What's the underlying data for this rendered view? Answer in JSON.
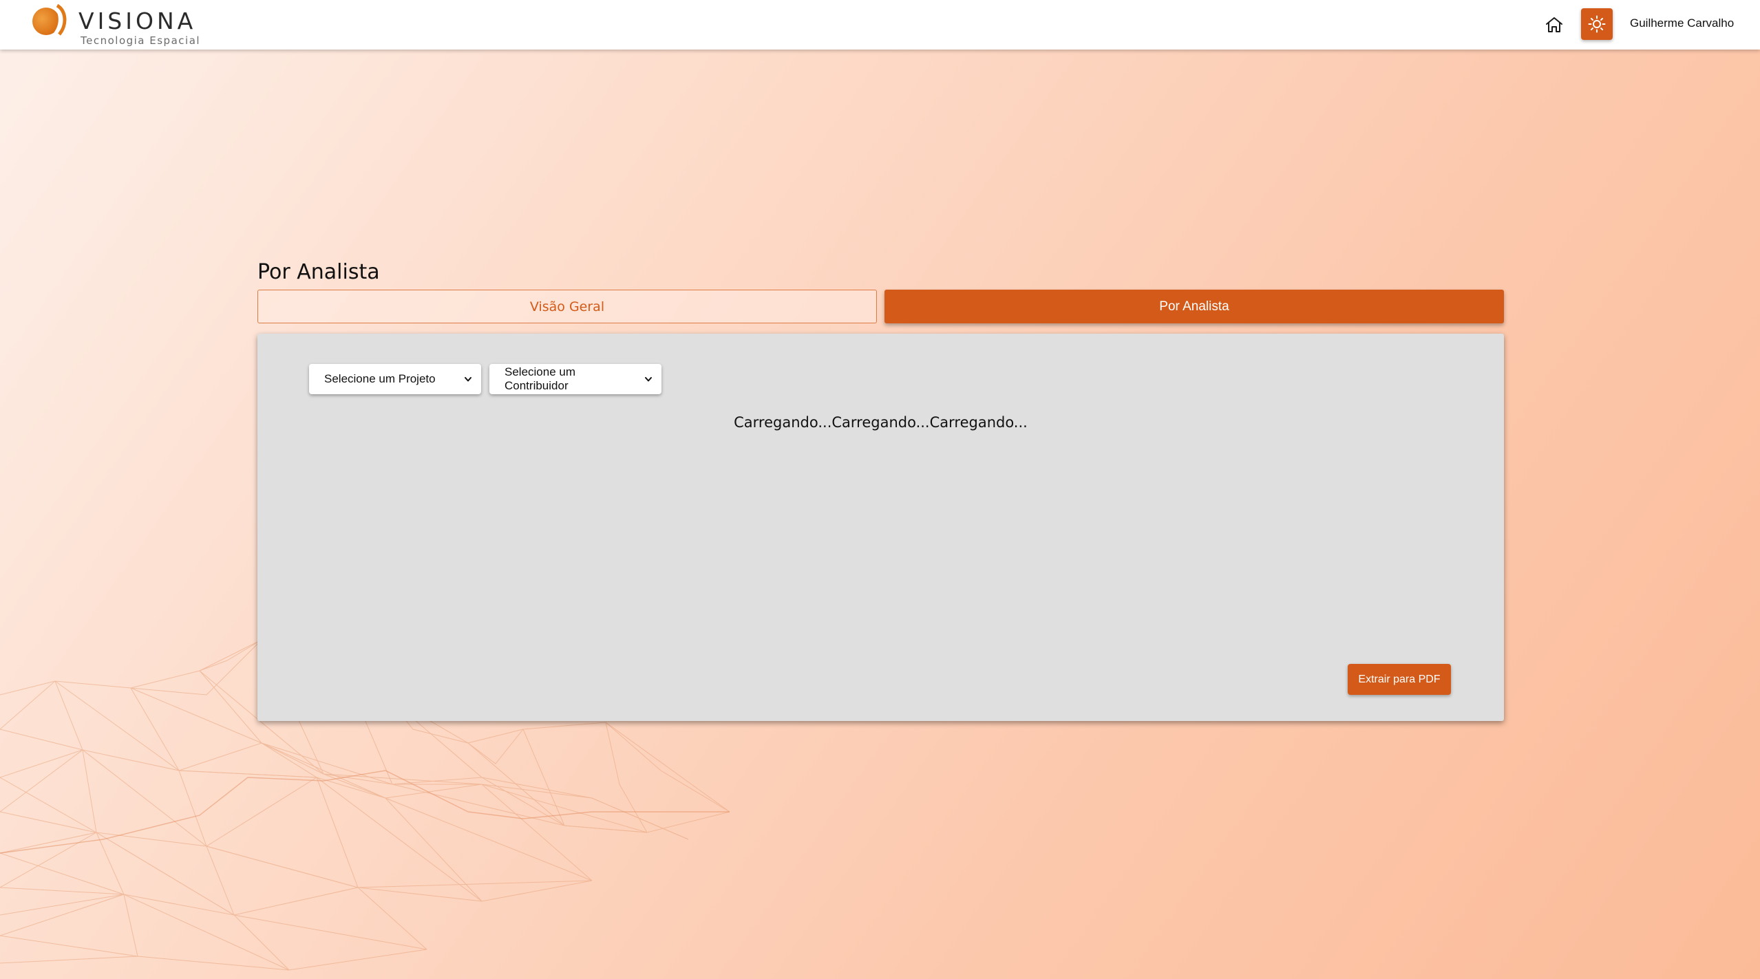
{
  "header": {
    "logo": {
      "wordmark": "VISIONA",
      "tagline": "Tecnologia Espacial"
    },
    "home_icon": "home-icon",
    "theme_icon": "sun-icon",
    "user_name": "Guilherme Carvalho"
  },
  "page": {
    "title": "Por Analista"
  },
  "tabs": [
    {
      "label": "Visão Geral",
      "active": false
    },
    {
      "label": "Por Analista",
      "active": true
    }
  ],
  "filters": {
    "project_select": {
      "selected": "Selecione um Projeto"
    },
    "contributor_select": {
      "selected": "Selecione um Contribuidor"
    }
  },
  "content": {
    "loading_text": "Carregando...Carregando...Carregando..."
  },
  "actions": {
    "export_pdf_label": "Extrair para PDF"
  },
  "colors": {
    "accent": "#d35a18",
    "panel_background": "#dfdfdf",
    "header_background": "#ffffff",
    "page_gradient_start": "#fdf0ea",
    "page_gradient_end": "#fbbb98"
  }
}
